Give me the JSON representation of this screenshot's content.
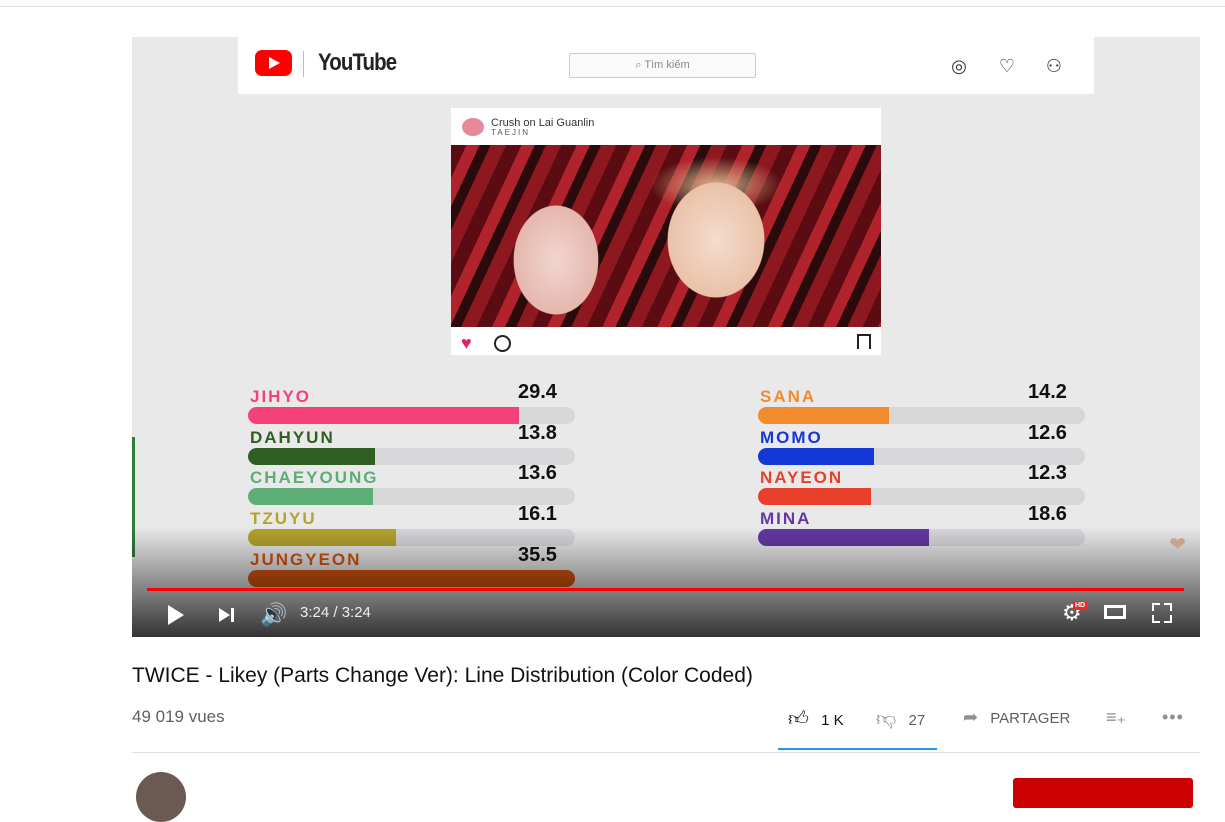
{
  "youtube_overlay": {
    "brand": "YouTube",
    "search_placeholder": "Tìm kiếm"
  },
  "insta_card": {
    "account": "Crush on Lai Guanlin",
    "subline": "TAEJIN"
  },
  "chart_data": {
    "type": "bar",
    "categories": [
      "JIHYO",
      "DAHYUN",
      "CHAEYOUNG",
      "TZUYU",
      "JUNGYEON",
      "SANA",
      "MOMO",
      "NAYEON",
      "MINA"
    ],
    "values": [
      29.4,
      13.8,
      13.6,
      16.1,
      35.5,
      14.2,
      12.6,
      12.3,
      18.6
    ],
    "value_labels": [
      "29.4",
      "13.8",
      "13.6",
      "16.1",
      "35.5",
      "14.2",
      "12.6",
      "12.3",
      "18.6"
    ],
    "colors": [
      "#f5407a",
      "#2f5f22",
      "#5cae76",
      "#b4a42c",
      "#d85510",
      "#f28a2e",
      "#1437d8",
      "#e8402a",
      "#6438a2"
    ],
    "xlim": [
      0,
      35.5
    ]
  },
  "player": {
    "time_display": "3:24 / 3:24",
    "progress": 1.0,
    "hd_label": "HD"
  },
  "video": {
    "title": "TWICE - Likey (Parts Change Ver): Line Distribution (Color Coded)",
    "views": "49 019 vues",
    "likes": "1 K",
    "dislikes": "27",
    "share_label": "PARTAGER",
    "accent_color": "#2196f3"
  }
}
